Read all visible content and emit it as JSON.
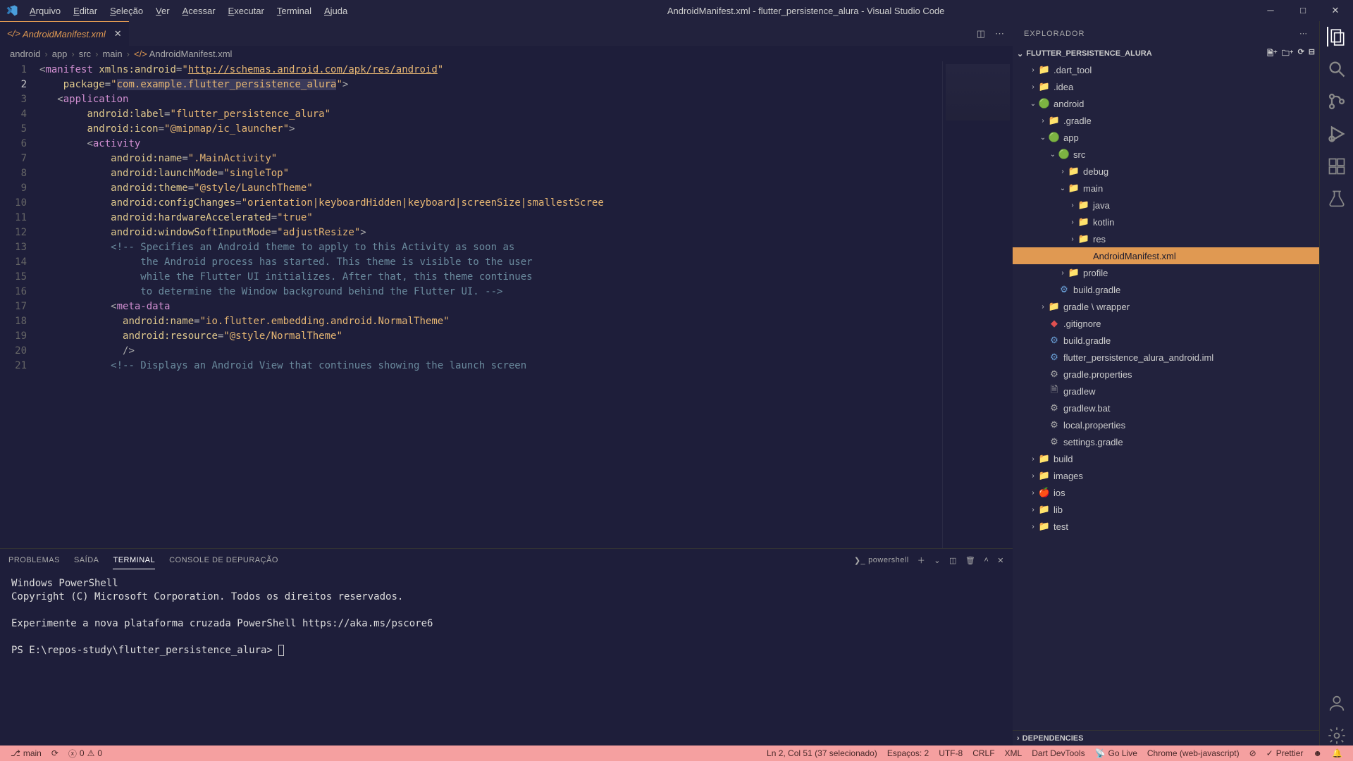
{
  "titlebar": {
    "title": "AndroidManifest.xml - flutter_persistence_alura - Visual Studio Code",
    "menu": [
      "Arquivo",
      "Editar",
      "Seleção",
      "Ver",
      "Acessar",
      "Executar",
      "Terminal",
      "Ajuda"
    ]
  },
  "tab": {
    "label": "AndroidManifest.xml"
  },
  "breadcrumb": [
    "android",
    "app",
    "src",
    "main",
    "AndroidManifest.xml"
  ],
  "explorer": {
    "title": "EXPLORADOR",
    "root": "FLUTTER_PERSISTENCE_ALURA",
    "deps": "DEPENDENCIES",
    "tree": [
      {
        "indent": 1,
        "chev": "›",
        "icon": "📁",
        "label": ".dart_tool",
        "color": "#d89040"
      },
      {
        "indent": 1,
        "chev": "›",
        "icon": "📁",
        "label": ".idea",
        "color": "#d89040"
      },
      {
        "indent": 1,
        "chev": "⌄",
        "icon": "🟢",
        "label": "android",
        "color": "#8fcf8f"
      },
      {
        "indent": 2,
        "chev": "›",
        "icon": "📁",
        "label": ".gradle",
        "color": "#6aa0d8"
      },
      {
        "indent": 2,
        "chev": "⌄",
        "icon": "🟢",
        "label": "app",
        "color": "#8fcf8f"
      },
      {
        "indent": 3,
        "chev": "⌄",
        "icon": "🟢",
        "label": "src",
        "color": "#8fcf8f"
      },
      {
        "indent": 4,
        "chev": "›",
        "icon": "📁",
        "label": "debug",
        "color": "#d89040"
      },
      {
        "indent": 4,
        "chev": "⌄",
        "icon": "📁",
        "label": "main",
        "color": "#d89040"
      },
      {
        "indent": 5,
        "chev": "›",
        "icon": "📁",
        "label": "java",
        "color": "#d89040"
      },
      {
        "indent": 5,
        "chev": "›",
        "icon": "📁",
        "label": "kotlin",
        "color": "#d89040"
      },
      {
        "indent": 5,
        "chev": "›",
        "icon": "📁",
        "label": "res",
        "color": "#d89040"
      },
      {
        "indent": 5,
        "chev": "",
        "icon": "</>",
        "label": "AndroidManifest.xml",
        "active": true,
        "color": "#e09952"
      },
      {
        "indent": 4,
        "chev": "›",
        "icon": "📁",
        "label": "profile",
        "color": "#d89040"
      },
      {
        "indent": 3,
        "chev": "",
        "icon": "⚙",
        "label": "build.gradle",
        "color": "#6aa0d8"
      },
      {
        "indent": 2,
        "chev": "›",
        "icon": "📁",
        "label": "gradle \\ wrapper",
        "color": "#d89040"
      },
      {
        "indent": 2,
        "chev": "",
        "icon": "◆",
        "label": ".gitignore",
        "color": "#e05050"
      },
      {
        "indent": 2,
        "chev": "",
        "icon": "⚙",
        "label": "build.gradle",
        "color": "#6aa0d8"
      },
      {
        "indent": 2,
        "chev": "",
        "icon": "⚙",
        "label": "flutter_persistence_alura_android.iml",
        "color": "#6aa0d8"
      },
      {
        "indent": 2,
        "chev": "",
        "icon": "⚙",
        "label": "gradle.properties",
        "color": "#aaa"
      },
      {
        "indent": 2,
        "chev": "",
        "icon": "🗎",
        "label": "gradlew",
        "color": "#aaa"
      },
      {
        "indent": 2,
        "chev": "",
        "icon": "⚙",
        "label": "gradlew.bat",
        "color": "#aaa"
      },
      {
        "indent": 2,
        "chev": "",
        "icon": "⚙",
        "label": "local.properties",
        "color": "#aaa"
      },
      {
        "indent": 2,
        "chev": "",
        "icon": "⚙",
        "label": "settings.gradle",
        "color": "#aaa"
      },
      {
        "indent": 1,
        "chev": "›",
        "icon": "📁",
        "label": "build",
        "color": "#d89040"
      },
      {
        "indent": 1,
        "chev": "›",
        "icon": "📁",
        "label": "images",
        "color": "#6aa0d8"
      },
      {
        "indent": 1,
        "chev": "›",
        "icon": "🍎",
        "label": "ios",
        "color": "#ccc"
      },
      {
        "indent": 1,
        "chev": "›",
        "icon": "📁",
        "label": "lib",
        "color": "#d89040"
      },
      {
        "indent": 1,
        "chev": "›",
        "icon": "📁",
        "label": "test",
        "color": "#d89040"
      }
    ]
  },
  "code": [
    {
      "n": 1,
      "html": "<span class='t-punc'>&lt;</span><span class='t-tag'>manifest</span> <span class='t-attr'>xmlns:android</span><span class='t-punc'>=</span><span class='t-str'>\"<u>http://schemas.android.com/apk/res/android</u>\"</span>"
    },
    {
      "n": 2,
      "cur": true,
      "html": "    <span class='t-attr'>package</span><span class='t-punc'>=</span><span class='t-str'>\"<span class='sel'>com.example.flutter_persistence_alura</span>\"</span><span class='t-punc'>&gt;</span>"
    },
    {
      "n": 3,
      "html": "   <span class='t-punc'>&lt;</span><span class='t-tag'>application</span>"
    },
    {
      "n": 4,
      "html": "        <span class='t-attr'>android:label</span><span class='t-punc'>=</span><span class='t-str'>\"flutter_persistence_alura\"</span>"
    },
    {
      "n": 5,
      "html": "        <span class='t-attr'>android:icon</span><span class='t-punc'>=</span><span class='t-str'>\"@mipmap/ic_launcher\"</span><span class='t-punc'>&gt;</span>"
    },
    {
      "n": 6,
      "html": "        <span class='t-punc'>&lt;</span><span class='t-tag'>activity</span>"
    },
    {
      "n": 7,
      "html": "            <span class='t-attr'>android:name</span><span class='t-punc'>=</span><span class='t-str'>\".MainActivity\"</span>"
    },
    {
      "n": 8,
      "html": "            <span class='t-attr'>android:launchMode</span><span class='t-punc'>=</span><span class='t-str'>\"singleTop\"</span>"
    },
    {
      "n": 9,
      "html": "            <span class='t-attr'>android:theme</span><span class='t-punc'>=</span><span class='t-str'>\"@style/LaunchTheme\"</span>"
    },
    {
      "n": 10,
      "html": "            <span class='t-attr'>android:configChanges</span><span class='t-punc'>=</span><span class='t-str'>\"orientation|keyboardHidden|keyboard|screenSize|smallestScree</span>"
    },
    {
      "n": 11,
      "html": "            <span class='t-attr'>android:hardwareAccelerated</span><span class='t-punc'>=</span><span class='t-str'>\"true\"</span>"
    },
    {
      "n": 12,
      "html": "            <span class='t-attr'>android:windowSoftInputMode</span><span class='t-punc'>=</span><span class='t-str'>\"adjustResize\"</span><span class='t-punc'>&gt;</span>"
    },
    {
      "n": 13,
      "html": "            <span class='t-cmt'>&lt;!-- Specifies an Android theme to apply to this Activity as soon as</span>"
    },
    {
      "n": 14,
      "html": "            <span class='t-cmt'>     the Android process has started. This theme is visible to the user</span>"
    },
    {
      "n": 15,
      "html": "            <span class='t-cmt'>     while the Flutter UI initializes. After that, this theme continues</span>"
    },
    {
      "n": 16,
      "html": "            <span class='t-cmt'>     to determine the Window background behind the Flutter UI. --&gt;</span>"
    },
    {
      "n": 17,
      "html": "            <span class='t-punc'>&lt;</span><span class='t-tag'>meta-data</span>"
    },
    {
      "n": 18,
      "html": "              <span class='t-attr'>android:name</span><span class='t-punc'>=</span><span class='t-str'>\"io.flutter.embedding.android.NormalTheme\"</span>"
    },
    {
      "n": 19,
      "html": "              <span class='t-attr'>android:resource</span><span class='t-punc'>=</span><span class='t-str'>\"@style/NormalTheme\"</span>"
    },
    {
      "n": 20,
      "html": "              <span class='t-punc'>/&gt;</span>"
    },
    {
      "n": 21,
      "html": "            <span class='t-cmt'>&lt;!-- Displays an Android View that continues showing the launch screen</span>"
    }
  ],
  "panel": {
    "tabs": [
      "PROBLEMAS",
      "SAÍDA",
      "TERMINAL",
      "CONSOLE DE DEPURAÇÃO"
    ],
    "active": 2,
    "termType": "powershell",
    "terminal": "Windows PowerShell\nCopyright (C) Microsoft Corporation. Todos os direitos reservados.\n\nExperimente a nova plataforma cruzada PowerShell https://aka.ms/pscore6\n\nPS E:\\repos-study\\flutter_persistence_alura> "
  },
  "status": {
    "branch": "main",
    "errors": "0",
    "warnings": "0",
    "selection": "Ln 2, Col 51 (37 selecionado)",
    "spaces": "Espaços: 2",
    "encoding": "UTF-8",
    "eol": "CRLF",
    "lang": "XML",
    "dart": "Dart DevTools",
    "golive": "Go Live",
    "chrome": "Chrome (web-javascript)",
    "prettier": "Prettier"
  }
}
